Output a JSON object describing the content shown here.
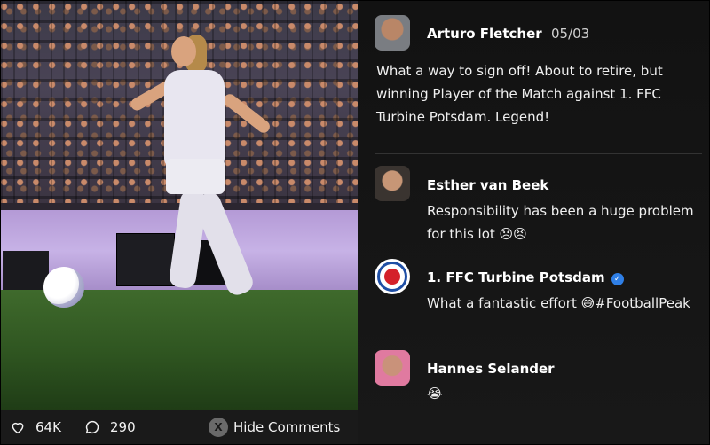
{
  "media": {
    "likes": "64K",
    "comments_count": "290",
    "toggle_key": "X",
    "hide_comments_label": "Hide Comments"
  },
  "post": {
    "author": "Arturo Fletcher",
    "date": "05/03",
    "text": "What a way to sign off! About to retire, but winning Player of the Match against 1. FFC Turbine Potsdam. Legend!"
  },
  "replies": [
    {
      "author": "Esther van Beek",
      "text": "Responsibility has been a huge problem for this lot 😞😣"
    },
    {
      "author": "1. FFC Turbine Potsdam",
      "verified": true,
      "text": "What a fantastic effort 😅#FootballPeak"
    },
    {
      "author": "Hannes Selander",
      "text": "😭"
    }
  ],
  "colors": {
    "verified_badge": "#2f7fe6",
    "panel_bg": "#141414"
  },
  "icons": {
    "likes": "heart-icon",
    "comments": "comment-bubble-icon",
    "verified": "verified-check-icon"
  }
}
